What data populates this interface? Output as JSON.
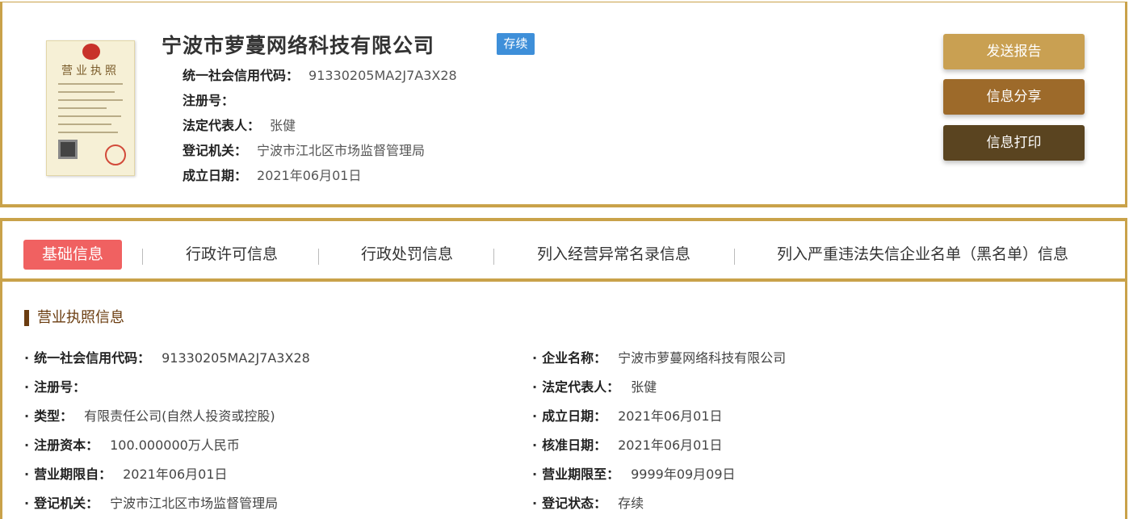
{
  "company": {
    "name": "宁波市萝蔓网络科技有限公司",
    "status": "存续",
    "license_image": {
      "title": "营业执照"
    },
    "details": [
      {
        "label": "统一社会信用代码：",
        "value": "91330205MA2J7A3X28"
      },
      {
        "label": "注册号：",
        "value": ""
      },
      {
        "label": "法定代表人：",
        "value": "张健"
      },
      {
        "label": "登记机关：",
        "value": "宁波市江北区市场监督管理局"
      },
      {
        "label": "成立日期：",
        "value": "2021年06月01日"
      }
    ]
  },
  "actions": {
    "send_report": "发送报告",
    "share": "信息分享",
    "print": "信息打印"
  },
  "tabs": [
    {
      "label": "基础信息"
    },
    {
      "label": "行政许可信息"
    },
    {
      "label": "行政处罚信息"
    },
    {
      "label": "列入经营异常名录信息"
    },
    {
      "label": "列入严重违法失信企业名单（黑名单）信息"
    }
  ],
  "section": {
    "title": "营业执照信息",
    "left": [
      {
        "label": "统一社会信用代码：",
        "value": "91330205MA2J7A3X28"
      },
      {
        "label": "注册号：",
        "value": ""
      },
      {
        "label": "类型：",
        "value": "有限责任公司(自然人投资或控股)"
      },
      {
        "label": "注册资本：",
        "value": "100.000000万人民币"
      },
      {
        "label": "营业期限自：",
        "value": "2021年06月01日"
      },
      {
        "label": "登记机关：",
        "value": "宁波市江北区市场监督管理局"
      }
    ],
    "right": [
      {
        "label": "企业名称：",
        "value": "宁波市萝蔓网络科技有限公司"
      },
      {
        "label": "法定代表人：",
        "value": "张健"
      },
      {
        "label": "成立日期：",
        "value": "2021年06月01日"
      },
      {
        "label": "核准日期：",
        "value": "2021年06月01日"
      },
      {
        "label": "营业期限至：",
        "value": "9999年09月09日"
      },
      {
        "label": "登记状态：",
        "value": "存续"
      }
    ]
  },
  "colors": {
    "gold_border": "#c9a24a",
    "status_blue": "#3e8fd9",
    "active_tab": "#f06161",
    "btn_send": "#c9a052",
    "btn_share": "#9d6a2a",
    "btn_print": "#5a4420"
  }
}
